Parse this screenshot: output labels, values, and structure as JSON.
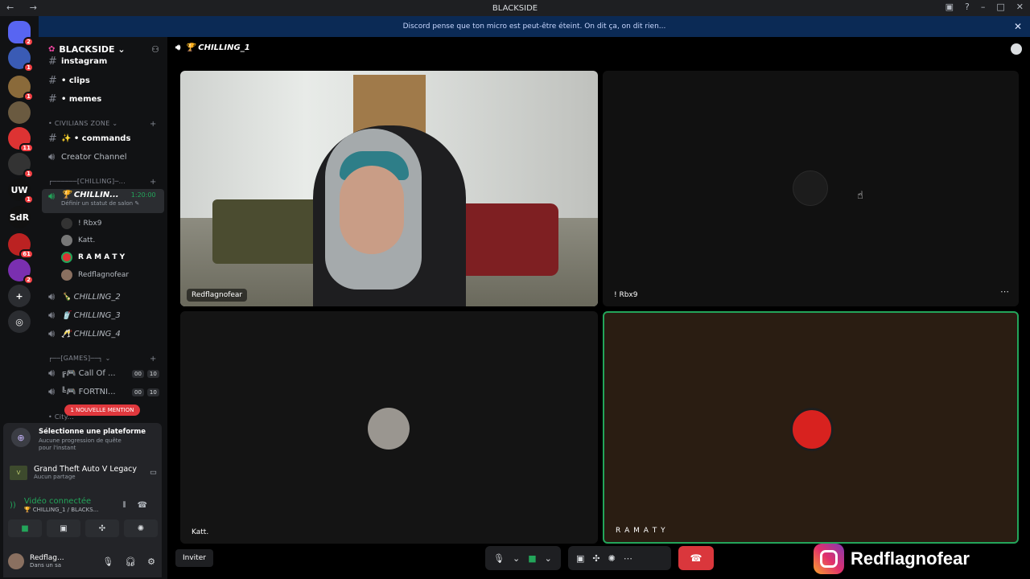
{
  "window": {
    "title": "BLACKSIDE",
    "nav": "← →"
  },
  "banner": {
    "text": "Discord pense que ton micro est peut-être éteint. On dit ça, on dit rien...",
    "close": "✕"
  },
  "guilds": [
    {
      "label": "",
      "color": "#5865f2",
      "badge": "2"
    },
    {
      "label": "",
      "color": "#3a5bb5",
      "badge": "1"
    },
    {
      "label": "",
      "color": "#8a6a3a",
      "badge": "1"
    },
    {
      "label": "",
      "color": "#6a5a40",
      "badge": ""
    },
    {
      "label": "",
      "color": "#d33",
      "badge": "11"
    },
    {
      "label": "",
      "color": "#333",
      "badge": "1"
    },
    {
      "label": "UW",
      "color": "#111",
      "badge": "1"
    },
    {
      "label": "SdR",
      "color": "#111",
      "badge": ""
    },
    {
      "label": "",
      "color": "#b22",
      "badge": "61"
    },
    {
      "label": "",
      "color": "#7a2fb0",
      "badge": "2"
    },
    {
      "label": "+",
      "color": "#2b2d31",
      "badge": ""
    },
    {
      "label": "◎",
      "color": "#2b2d31",
      "badge": ""
    }
  ],
  "server": {
    "name": "BLACKSIDE ⌄"
  },
  "channels": {
    "instagram": "instagram",
    "clips": "• clips",
    "memes": "• memes",
    "cat_civilians": "• CIVILIANS ZONE ⌄",
    "commands": "✨ • commands",
    "creator": "Creator Channel",
    "cat_chilling": "┌──────[CHILLING]─...",
    "active": {
      "name": "🏆 CHILLIN...",
      "time": "1:20:00",
      "status": "Définir un statut de salon ✎"
    },
    "users": [
      {
        "name": "! Rbx9"
      },
      {
        "name": "Katt."
      },
      {
        "name": "R A M A T Y"
      },
      {
        "name": "Redflagnofear"
      }
    ],
    "chilling2": "🍾 CHILLING_2",
    "chilling3": "🥤 CHILLING_3",
    "chilling4": "🥂 CHILLING_4",
    "cat_games": "┌──[GAMES]──┐ ⌄",
    "cod": "╔🎮 Call Of ...",
    "cod_a": "00",
    "cod_b": "10",
    "fortnite": "╚🎮 FORTNI...",
    "fn_a": "00",
    "fn_b": "10",
    "cat_city": "• City...",
    "mention": "1 NOUVELLE MENTION"
  },
  "quest": {
    "title": "Sélectionne une plateforme",
    "sub": "Aucune progression de quête pour l'instant"
  },
  "game": {
    "title": "Grand Theft Auto V Legacy",
    "sub": "Aucun partage"
  },
  "voice": {
    "status": "Vidéo connectée",
    "sub": "🏆 CHILLING_1 / BLACKS..."
  },
  "me": {
    "name": "Redflag...",
    "status": "Dans un sa"
  },
  "main": {
    "channel": "🏆 CHILLING_1",
    "tiles": [
      {
        "name": "Redflagnofear"
      },
      {
        "name": "! Rbx9"
      },
      {
        "name": "Katt."
      },
      {
        "name": "R A M A T Y"
      }
    ],
    "invite": "Inviter",
    "watermark": "Redflagnofear"
  }
}
